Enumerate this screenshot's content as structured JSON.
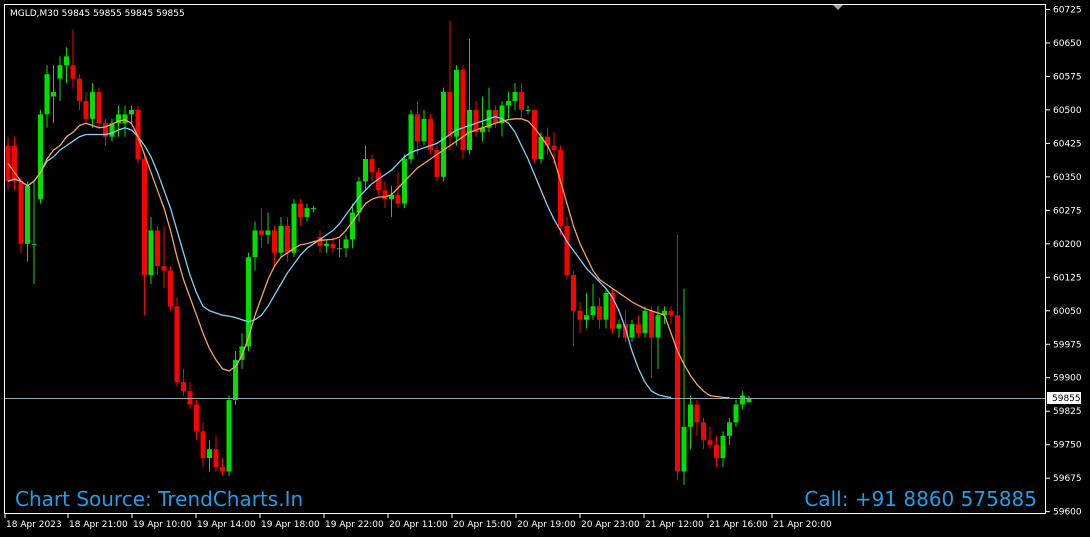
{
  "header": {
    "text": "MGLD,M30  59845 59855 59845 59855"
  },
  "watermark_left": "Chart Source: TrendCharts.In",
  "watermark_right": "Call: +91 8860 575885",
  "current_price_label": "59855",
  "colors": {
    "background": "#000000",
    "bull": "#00e000",
    "bear": "#ff0000",
    "ma_fast": "#f4a460",
    "ma_slow": "#87cefa",
    "axis": "#ffffff",
    "price_line": "#8fa6b4",
    "watermark": "#1e9fe8"
  },
  "chart_data": {
    "type": "candlestick",
    "symbol": "MGLD",
    "timeframe": "M30",
    "y_ticks": [
      60725,
      60650,
      60575,
      60500,
      60425,
      60350,
      60275,
      60200,
      60125,
      60050,
      59975,
      59900,
      59825,
      59750,
      59675,
      59600
    ],
    "ylim": [
      59597,
      60735
    ],
    "x_labels": [
      "18 Apr 2023",
      "18 Apr 21:00",
      "19 Apr 10:00",
      "19 Apr 14:00",
      "19 Apr 18:00",
      "19 Apr 22:00",
      "20 Apr 11:00",
      "20 Apr 15:00",
      "20 Apr 19:00",
      "20 Apr 23:00",
      "21 Apr 12:00",
      "21 Apr 16:00",
      "21 Apr 20:00"
    ],
    "current_price": 59855,
    "candles": [
      {
        "o": 60420,
        "h": 60440,
        "l": 60320,
        "c": 60340
      },
      {
        "o": 60420,
        "h": 60440,
        "l": 60320,
        "c": 60340
      },
      {
        "o": 60340,
        "h": 60350,
        "l": 60180,
        "c": 60200
      },
      {
        "o": 60200,
        "h": 60340,
        "l": 60160,
        "c": 60330
      },
      {
        "o": 60200,
        "h": 60340,
        "l": 60110,
        "c": 60200
      },
      {
        "o": 60300,
        "h": 60500,
        "l": 60290,
        "c": 60490
      },
      {
        "o": 60490,
        "h": 60600,
        "l": 60460,
        "c": 60580
      },
      {
        "o": 60530,
        "h": 60600,
        "l": 60470,
        "c": 60540
      },
      {
        "o": 60570,
        "h": 60620,
        "l": 60520,
        "c": 60600
      },
      {
        "o": 60600,
        "h": 60640,
        "l": 60560,
        "c": 60620
      },
      {
        "o": 60600,
        "h": 60680,
        "l": 60550,
        "c": 60570
      },
      {
        "o": 60570,
        "h": 60580,
        "l": 60500,
        "c": 60520
      },
      {
        "o": 60520,
        "h": 60540,
        "l": 60470,
        "c": 60480
      },
      {
        "o": 60480,
        "h": 60560,
        "l": 60460,
        "c": 60540
      },
      {
        "o": 60540,
        "h": 60550,
        "l": 60460,
        "c": 60470
      },
      {
        "o": 60470,
        "h": 60480,
        "l": 60420,
        "c": 60440
      },
      {
        "o": 60440,
        "h": 60480,
        "l": 60430,
        "c": 60470
      },
      {
        "o": 60470,
        "h": 60510,
        "l": 60440,
        "c": 60490
      },
      {
        "o": 60470,
        "h": 60510,
        "l": 60440,
        "c": 60490
      },
      {
        "o": 60490,
        "h": 60510,
        "l": 60470,
        "c": 60500
      },
      {
        "o": 60500,
        "h": 60510,
        "l": 60380,
        "c": 60390
      },
      {
        "o": 60390,
        "h": 60400,
        "l": 60040,
        "c": 60130
      },
      {
        "o": 60130,
        "h": 60260,
        "l": 60110,
        "c": 60230
      },
      {
        "o": 60230,
        "h": 60240,
        "l": 60130,
        "c": 60150
      },
      {
        "o": 60150,
        "h": 60240,
        "l": 60100,
        "c": 60140
      },
      {
        "o": 60140,
        "h": 60150,
        "l": 60050,
        "c": 60060
      },
      {
        "o": 60060,
        "h": 60080,
        "l": 59880,
        "c": 59890
      },
      {
        "o": 59890,
        "h": 59920,
        "l": 59860,
        "c": 59870
      },
      {
        "o": 59870,
        "h": 59890,
        "l": 59830,
        "c": 59840
      },
      {
        "o": 59840,
        "h": 59850,
        "l": 59760,
        "c": 59780
      },
      {
        "o": 59780,
        "h": 59800,
        "l": 59700,
        "c": 59720
      },
      {
        "o": 59720,
        "h": 59760,
        "l": 59690,
        "c": 59740
      },
      {
        "o": 59740,
        "h": 59770,
        "l": 59690,
        "c": 59700
      },
      {
        "o": 59700,
        "h": 59720,
        "l": 59680,
        "c": 59690
      },
      {
        "o": 59690,
        "h": 59860,
        "l": 59680,
        "c": 59850
      },
      {
        "o": 59850,
        "h": 59960,
        "l": 59840,
        "c": 59940
      },
      {
        "o": 59940,
        "h": 60000,
        "l": 59920,
        "c": 59970
      },
      {
        "o": 59970,
        "h": 60180,
        "l": 59960,
        "c": 60170
      },
      {
        "o": 60170,
        "h": 60250,
        "l": 60140,
        "c": 60230
      },
      {
        "o": 60230,
        "h": 60280,
        "l": 60190,
        "c": 60220
      },
      {
        "o": 60220,
        "h": 60270,
        "l": 60200,
        "c": 60230
      },
      {
        "o": 60230,
        "h": 60240,
        "l": 60150,
        "c": 60180
      },
      {
        "o": 60180,
        "h": 60260,
        "l": 60170,
        "c": 60240
      },
      {
        "o": 60240,
        "h": 60260,
        "l": 60160,
        "c": 60180
      },
      {
        "o": 60180,
        "h": 60300,
        "l": 60170,
        "c": 60290
      },
      {
        "o": 60290,
        "h": 60300,
        "l": 60240,
        "c": 60260
      },
      {
        "o": 60260,
        "h": 60290,
        "l": 60250,
        "c": 60280
      },
      {
        "o": 60280,
        "h": 60285,
        "l": 60270,
        "c": 60280
      },
      {
        "o": 60215,
        "h": 60230,
        "l": 60180,
        "c": 60195
      },
      {
        "o": 60195,
        "h": 60210,
        "l": 60180,
        "c": 60200
      },
      {
        "o": 60200,
        "h": 60215,
        "l": 60180,
        "c": 60190
      },
      {
        "o": 60190,
        "h": 60210,
        "l": 60170,
        "c": 60190
      },
      {
        "o": 60190,
        "h": 60220,
        "l": 60170,
        "c": 60210
      },
      {
        "o": 60210,
        "h": 60290,
        "l": 60190,
        "c": 60270
      },
      {
        "o": 60270,
        "h": 60350,
        "l": 60250,
        "c": 60340
      },
      {
        "o": 60340,
        "h": 60420,
        "l": 60320,
        "c": 60390
      },
      {
        "o": 60390,
        "h": 60400,
        "l": 60340,
        "c": 60360
      },
      {
        "o": 60360,
        "h": 60370,
        "l": 60310,
        "c": 60320
      },
      {
        "o": 60320,
        "h": 60340,
        "l": 60280,
        "c": 60300
      },
      {
        "o": 60300,
        "h": 60330,
        "l": 60260,
        "c": 60310
      },
      {
        "o": 60310,
        "h": 60360,
        "l": 60280,
        "c": 60290
      },
      {
        "o": 60290,
        "h": 60400,
        "l": 60280,
        "c": 60390
      },
      {
        "o": 60390,
        "h": 60500,
        "l": 60380,
        "c": 60490
      },
      {
        "o": 60490,
        "h": 60520,
        "l": 60400,
        "c": 60430
      },
      {
        "o": 60430,
        "h": 60500,
        "l": 60420,
        "c": 60480
      },
      {
        "o": 60480,
        "h": 60490,
        "l": 60400,
        "c": 60410
      },
      {
        "o": 60410,
        "h": 60420,
        "l": 60340,
        "c": 60350
      },
      {
        "o": 60350,
        "h": 60550,
        "l": 60340,
        "c": 60540
      },
      {
        "o": 60540,
        "h": 60700,
        "l": 60410,
        "c": 60440
      },
      {
        "o": 60440,
        "h": 60600,
        "l": 60420,
        "c": 60590
      },
      {
        "o": 60590,
        "h": 60600,
        "l": 60390,
        "c": 60410
      },
      {
        "o": 60410,
        "h": 60660,
        "l": 60400,
        "c": 60500
      },
      {
        "o": 60500,
        "h": 60520,
        "l": 60440,
        "c": 60450
      },
      {
        "o": 60450,
        "h": 60530,
        "l": 60430,
        "c": 60460
      },
      {
        "o": 60460,
        "h": 60550,
        "l": 60450,
        "c": 60500
      },
      {
        "o": 60500,
        "h": 60510,
        "l": 60460,
        "c": 60470
      },
      {
        "o": 60470,
        "h": 60520,
        "l": 60440,
        "c": 60510
      },
      {
        "o": 60510,
        "h": 60540,
        "l": 60480,
        "c": 60520
      },
      {
        "o": 60520,
        "h": 60560,
        "l": 60500,
        "c": 60540
      },
      {
        "o": 60540,
        "h": 60560,
        "l": 60480,
        "c": 60500
      },
      {
        "o": 60500,
        "h": 60510,
        "l": 60490,
        "c": 60500
      },
      {
        "o": 60500,
        "h": 60500,
        "l": 60380,
        "c": 60390
      },
      {
        "o": 60390,
        "h": 60450,
        "l": 60380,
        "c": 60440
      },
      {
        "o": 60440,
        "h": 60460,
        "l": 60400,
        "c": 60420
      },
      {
        "o": 60420,
        "h": 60450,
        "l": 60380,
        "c": 60410
      },
      {
        "o": 60410,
        "h": 60420,
        "l": 60220,
        "c": 60240
      },
      {
        "o": 60240,
        "h": 60260,
        "l": 60120,
        "c": 60130
      },
      {
        "o": 60130,
        "h": 60140,
        "l": 59970,
        "c": 60050
      },
      {
        "o": 60050,
        "h": 60070,
        "l": 60000,
        "c": 60030
      },
      {
        "o": 60030,
        "h": 60090,
        "l": 60010,
        "c": 60040
      },
      {
        "o": 60040,
        "h": 60110,
        "l": 60030,
        "c": 60060
      },
      {
        "o": 60060,
        "h": 60080,
        "l": 60010,
        "c": 60030
      },
      {
        "o": 60030,
        "h": 60100,
        "l": 60010,
        "c": 60090
      },
      {
        "o": 60090,
        "h": 60100,
        "l": 60000,
        "c": 60010
      },
      {
        "o": 60010,
        "h": 60030,
        "l": 59990,
        "c": 60020
      },
      {
        "o": 60020,
        "h": 60050,
        "l": 59980,
        "c": 59990
      },
      {
        "o": 59990,
        "h": 60030,
        "l": 59980,
        "c": 60020
      },
      {
        "o": 60020,
        "h": 60040,
        "l": 59990,
        "c": 60000
      },
      {
        "o": 60000,
        "h": 60060,
        "l": 59990,
        "c": 60050
      },
      {
        "o": 60050,
        "h": 60060,
        "l": 59900,
        "c": 59990
      },
      {
        "o": 59990,
        "h": 60060,
        "l": 59920,
        "c": 60040
      },
      {
        "o": 60040,
        "h": 60060,
        "l": 60020,
        "c": 60050
      },
      {
        "o": 60050,
        "h": 60060,
        "l": 60020,
        "c": 60040
      },
      {
        "o": 60040,
        "h": 60220,
        "l": 59670,
        "c": 59690
      },
      {
        "o": 59690,
        "h": 60100,
        "l": 59660,
        "c": 59790
      },
      {
        "o": 59790,
        "h": 59860,
        "l": 59740,
        "c": 59840
      },
      {
        "o": 59840,
        "h": 59850,
        "l": 59770,
        "c": 59800
      },
      {
        "o": 59800,
        "h": 59810,
        "l": 59740,
        "c": 59760
      },
      {
        "o": 59760,
        "h": 59790,
        "l": 59740,
        "c": 59750
      },
      {
        "o": 59750,
        "h": 59770,
        "l": 59700,
        "c": 59720
      },
      {
        "o": 59720,
        "h": 59780,
        "l": 59700,
        "c": 59770
      },
      {
        "o": 59770,
        "h": 59810,
        "l": 59750,
        "c": 59800
      },
      {
        "o": 59800,
        "h": 59850,
        "l": 59790,
        "c": 59840
      },
      {
        "o": 59840,
        "h": 59870,
        "l": 59830,
        "c": 59860
      },
      {
        "o": 59845,
        "h": 59860,
        "l": 59845,
        "c": 59855
      }
    ],
    "ma_fast": [
      60380,
      60360,
      60340,
      60330,
      60340,
      60360,
      60390,
      60410,
      60420,
      60440,
      60450,
      60465,
      60470,
      60465,
      60460,
      60462,
      60468,
      60475,
      60478,
      60470,
      60440,
      60400,
      60360,
      60320,
      60280,
      60230,
      60170,
      60120,
      60080,
      60040,
      60000,
      59965,
      59940,
      59920,
      59915,
      59925,
      59950,
      59990,
      60040,
      60080,
      60120,
      60150,
      60170,
      60180,
      60190,
      60198,
      60200,
      60205,
      60208,
      60209,
      60210,
      60215,
      60230,
      60250,
      60270,
      60290,
      60300,
      60305,
      60305,
      60310,
      60325,
      60340,
      60355,
      60370,
      60380,
      60390,
      60400,
      60410,
      60420,
      60430,
      60440,
      60450,
      60455,
      60460,
      60465,
      60470,
      60475,
      60478,
      60480,
      60480,
      60475,
      60460,
      60440,
      60420,
      60390,
      60340,
      60290,
      60240,
      60200,
      60170,
      60140,
      60120,
      60110,
      60100,
      60090,
      60080,
      60070,
      60062,
      60055,
      60050,
      60045,
      60040,
      60000,
      59960,
      59930,
      59905,
      59885,
      59870,
      59860,
      59858,
      59856,
      59855
    ],
    "ma_slow": [
      60340,
      60345,
      60340,
      60330,
      60340,
      60360,
      60385,
      60395,
      60410,
      60420,
      60430,
      60440,
      60445,
      60445,
      60445,
      60445,
      60448,
      60455,
      60460,
      60455,
      60440,
      60420,
      60395,
      60360,
      60320,
      60280,
      60230,
      60180,
      60130,
      60090,
      60060,
      60050,
      60045,
      60040,
      60038,
      60035,
      60030,
      60025,
      60030,
      60040,
      60060,
      60085,
      60110,
      60135,
      60155,
      60175,
      60190,
      60200,
      60210,
      60220,
      60230,
      60245,
      60265,
      60285,
      60305,
      60320,
      60335,
      60345,
      60355,
      60365,
      60380,
      60395,
      60405,
      60410,
      60415,
      60420,
      60425,
      60435,
      60445,
      60455,
      60460,
      60465,
      60470,
      60475,
      60480,
      60485,
      60480,
      60470,
      60450,
      60420,
      60390,
      60355,
      60320,
      60285,
      60255,
      60230,
      60205,
      60185,
      60165,
      60145,
      60130,
      60115,
      60100,
      60080,
      60050,
      60010,
      59960,
      59920,
      59890,
      59870,
      59862,
      59858,
      59856
    ]
  }
}
